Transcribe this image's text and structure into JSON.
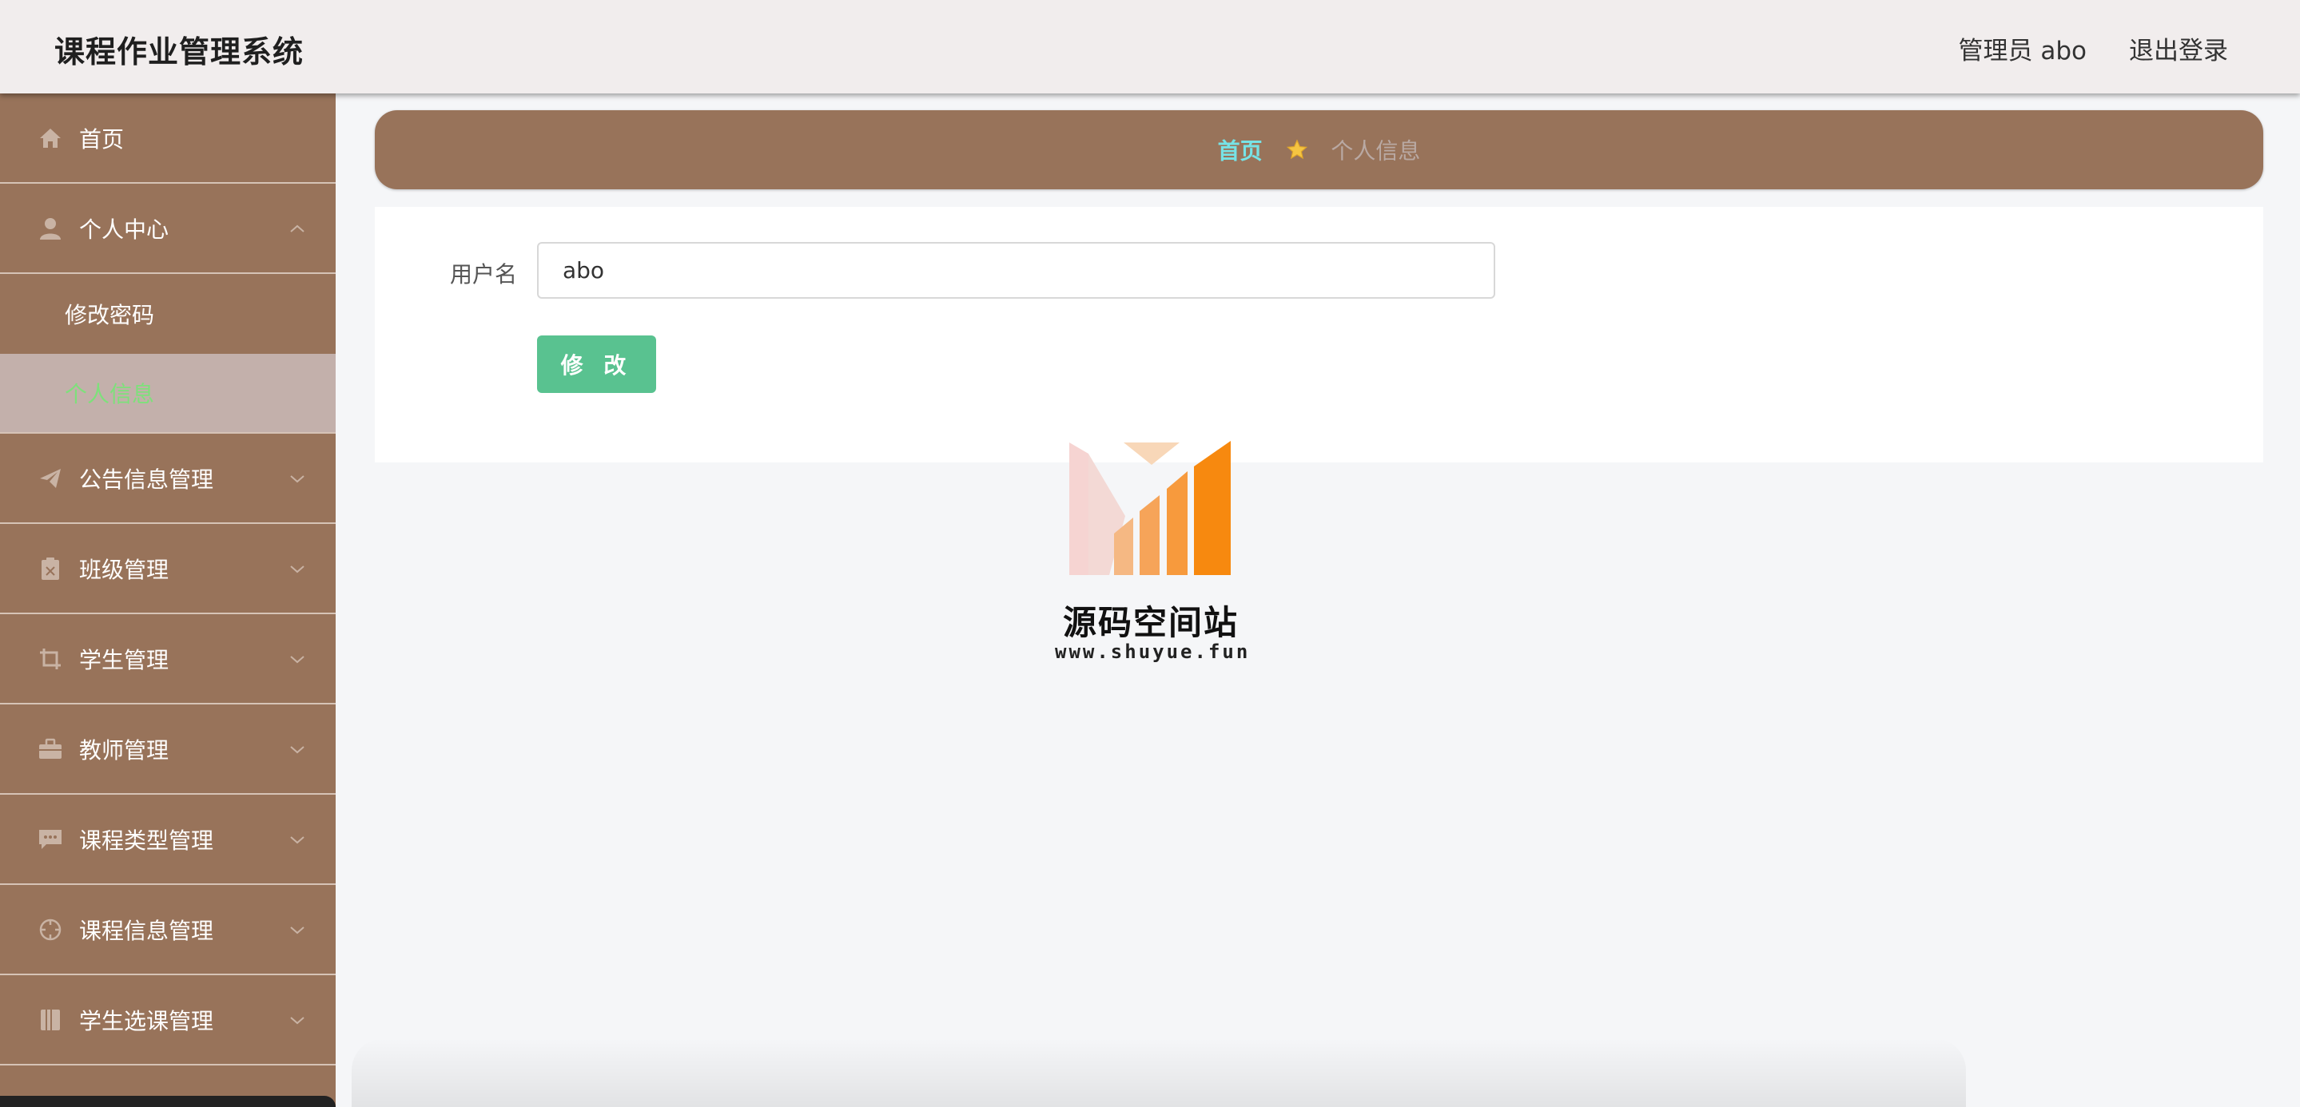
{
  "header": {
    "title": "课程作业管理系统",
    "user_label": "管理员 abo",
    "logout_label": "退出登录"
  },
  "sidebar": {
    "home": {
      "label": "首页",
      "icon": "home-icon"
    },
    "personal_center": {
      "label": "个人中心",
      "icon": "user-icon",
      "expanded": true,
      "children": [
        {
          "label": "修改密码",
          "active": false
        },
        {
          "label": "个人信息",
          "active": true
        }
      ]
    },
    "items": [
      {
        "label": "公告信息管理",
        "icon": "paper-plane-icon"
      },
      {
        "label": "班级管理",
        "icon": "clipboard-icon"
      },
      {
        "label": "学生管理",
        "icon": "crop-icon"
      },
      {
        "label": "教师管理",
        "icon": "briefcase-icon"
      },
      {
        "label": "课程类型管理",
        "icon": "chat-icon"
      },
      {
        "label": "课程信息管理",
        "icon": "compass-icon"
      },
      {
        "label": "学生选课管理",
        "icon": "book-icon"
      }
    ]
  },
  "breadcrumb": {
    "home": "首页",
    "separator_icon": "star-icon",
    "current": "个人信息"
  },
  "form": {
    "username_label": "用户名",
    "username_value": "abo",
    "submit_label": "修 改"
  },
  "watermark": {
    "title": "源码空间站",
    "url": "www.shuyue.fun"
  },
  "colors": {
    "sidebar_bg": "#98735a",
    "active_text": "#7ee07b",
    "breadcrumb_home": "#76e3e6",
    "button": "#59c290",
    "topbar_bg": "#f1eded"
  }
}
